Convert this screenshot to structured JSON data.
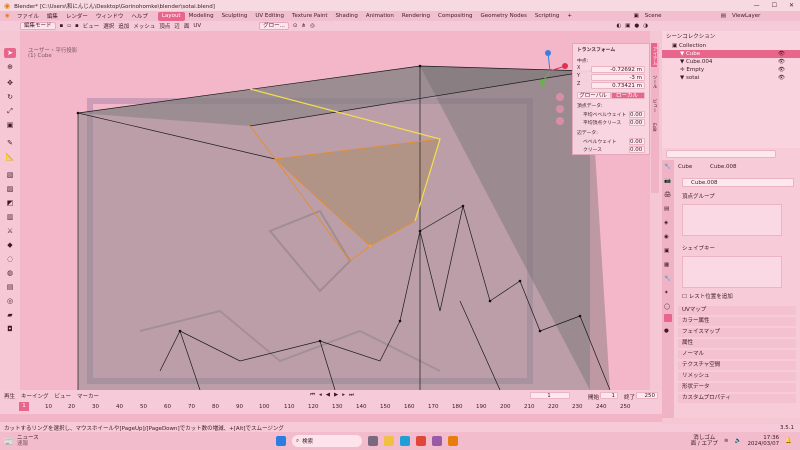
{
  "window": {
    "title": "Blender* [C:\\Users\\和にんじん\\Desktop\\Gorinohomke\\blender\\sotai.blend]"
  },
  "menu": [
    "ファイル",
    "編集",
    "レンダー",
    "ウィンドウ",
    "ヘルプ"
  ],
  "workspaces": [
    "Layout",
    "Modeling",
    "Sculpting",
    "UV Editing",
    "Texture Paint",
    "Shading",
    "Animation",
    "Rendering",
    "Compositing",
    "Geometry Nodes",
    "Scripting"
  ],
  "active_workspace": "Layout",
  "scene": {
    "label": "Scene",
    "view_layer": "ViewLayer"
  },
  "header": {
    "mode": "編集モード",
    "items": [
      "ビュー",
      "選択",
      "追加",
      "メッシュ",
      "頂点",
      "辺",
      "面",
      "UV"
    ],
    "orientation": "グロー...",
    "xyz": "X Y Z",
    "options": "オプション"
  },
  "viewport": {
    "view_name": "ユーザー・平行投影",
    "object_name": "(1) Cube"
  },
  "transform": {
    "title": "トランスフォーム",
    "median": "中点:",
    "x_label": "X",
    "x": "-0.72692 m",
    "y_label": "Y",
    "y": "-3 m",
    "z_label": "Z",
    "z": "0.73421 m",
    "global": "グローバル",
    "local": "ローカル",
    "vertex_data": "頂点データ:",
    "mean_bevel_weight": "平均ベベルウェイト",
    "mean_bevel_weight_val": "0.00",
    "mean_vertex_crease": "平均頂点クリース",
    "mean_vertex_crease_val": "0.00",
    "edge_data": "辺データ:",
    "bevel_weight": "ベベルウェイト",
    "bevel_weight_val": "0.00",
    "crease": "クリース",
    "crease_val": "0.00"
  },
  "npanel_tabs": [
    "アイテム",
    "ツール",
    "ビュー",
    "Edit"
  ],
  "outliner": {
    "title": "シーンコレクション",
    "rows": [
      "Collection",
      "Cube",
      "Cube.004",
      "Empty",
      "sotai"
    ]
  },
  "properties": {
    "breadcrumb_object": "Cube",
    "breadcrumb_mesh": "Cube.008",
    "mesh_name": "Cube.008",
    "vertex_groups": "頂点グループ",
    "shape_keys": "シェイプキー",
    "add_rest_position": "レスト位置を追加",
    "panels": [
      "UVマップ",
      "カラー属性",
      "フェイスマップ",
      "属性",
      "ノーマル",
      "テクスチャ空間",
      "リメッシュ",
      "形状データ",
      "カスタムプロパティ"
    ]
  },
  "timeline": {
    "menu": [
      "再生",
      "キーイング",
      "ビュー",
      "マーカー"
    ],
    "current_frame": "1",
    "start_label": "開始",
    "start": "1",
    "end_label": "終了",
    "end": "250",
    "ticks": [
      "1",
      "10",
      "20",
      "30",
      "40",
      "50",
      "60",
      "70",
      "80",
      "90",
      "100",
      "110",
      "120",
      "130",
      "140",
      "150",
      "160",
      "170",
      "180",
      "190",
      "200",
      "210",
      "220",
      "230",
      "240",
      "250"
    ]
  },
  "statusbar": {
    "hint": "カットするリングを選択し、マウスホイールや[PageUp]/[PageDown]でカット数の増減、+[Alt]でスムージング",
    "version": "3.5.1"
  },
  "taskbar": {
    "news": "ニュース",
    "news_sub": "速報",
    "search": "検索",
    "time": "17:36",
    "date": "2024/03/07",
    "ime": "消しゴム",
    "ime2": "面 / エアブ"
  },
  "colors": {
    "accent": "#e8668c",
    "background": "#f5c6d3",
    "mesh_select": "#f0a040"
  }
}
